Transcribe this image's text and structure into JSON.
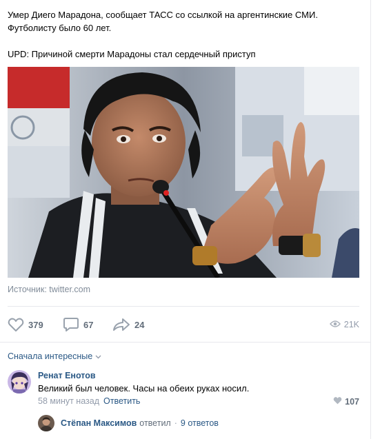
{
  "post": {
    "line1": "Умер Диего Марадона, сообщает ТАСС со ссылкой на аргентинские СМИ.",
    "line2": "Футболисту было 60 лет.",
    "line3": "UPD: Причиной смерти Марадоны стал сердечный приступ",
    "photo_alt": "Фото",
    "source": "Источник: twitter.com"
  },
  "actions": {
    "likes": "379",
    "comments": "67",
    "shares": "24",
    "views": "21K"
  },
  "icons": {
    "like": "heart-icon",
    "comment": "comment-icon",
    "share": "share-arrow-icon",
    "views": "eye-icon",
    "sort": "chevron-down-icon"
  },
  "comments_sort": "Сначала интересные",
  "comment": {
    "author": "Ренат Енотов",
    "text": "Великий был человек. Часы на обеих руках носил.",
    "time": "58 минут назад",
    "reply_label": "Ответить",
    "likes": "107"
  },
  "thread": {
    "author": "Стёпан Максимов",
    "replied": "ответил",
    "count": "9 ответов"
  },
  "colors": {
    "link": "#2a5885",
    "muted": "#939cab",
    "action": "#626d7a",
    "separator": "#e7e8ec"
  }
}
